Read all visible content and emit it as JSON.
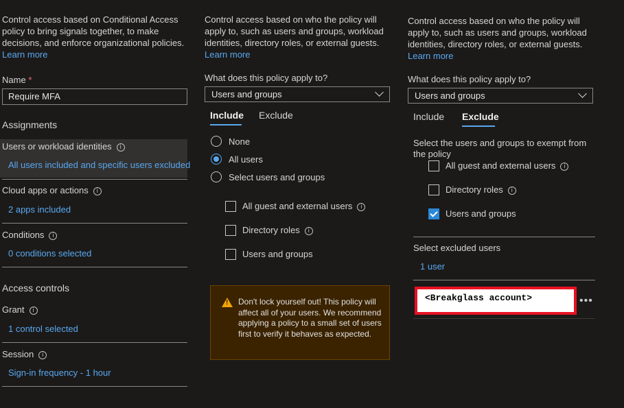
{
  "left": {
    "description": "Control access based on Conditional Access policy to bring signals together, to make decisions, and enforce organizational policies.",
    "learn_more": "Learn more",
    "name_label": "Name",
    "required_mark": "*",
    "name_value": "Require MFA",
    "assignments_heading": "Assignments",
    "users_label": "Users or workload identities",
    "users_value": "All users included and specific users excluded",
    "apps_label": "Cloud apps or actions",
    "apps_value": "2 apps included",
    "conditions_label": "Conditions",
    "conditions_value": "0 conditions selected",
    "access_heading": "Access controls",
    "grant_label": "Grant",
    "grant_value": "1 control selected",
    "session_label": "Session",
    "session_value": "Sign-in frequency - 1 hour"
  },
  "middle": {
    "description": "Control access based on who the policy will apply to, such as users and groups, workload identities, directory roles, or external guests.",
    "learn_more": "Learn more",
    "apply_label": "What does this policy apply to?",
    "apply_value": "Users and groups",
    "tab_include": "Include",
    "tab_exclude": "Exclude",
    "radio_none": "None",
    "radio_all": "All users",
    "radio_select": "Select users and groups",
    "check_guest": "All guest and external users",
    "check_roles": "Directory roles",
    "check_users": "Users and groups",
    "warning": "Don't lock yourself out! This policy will affect all of your users. We recommend applying a policy to a small set of users first to verify it behaves as expected."
  },
  "right": {
    "description": "Control access based on who the policy will apply to, such as users and groups, workload identities, directory roles, or external guests.",
    "learn_more": "Learn more",
    "apply_label": "What does this policy apply to?",
    "apply_value": "Users and groups",
    "tab_include": "Include",
    "tab_exclude": "Exclude",
    "exempt_text": "Select the users and groups to exempt from the policy",
    "check_guest": "All guest and external users",
    "check_roles": "Directory roles",
    "check_users": "Users and groups",
    "excluded_label": "Select excluded users",
    "excluded_count": "1 user",
    "account": "<Breakglass account>",
    "more": "•••"
  },
  "colors": {
    "accent": "#5aa8f0",
    "highlight": "#e81123",
    "warning_bg": "#3b2300"
  }
}
